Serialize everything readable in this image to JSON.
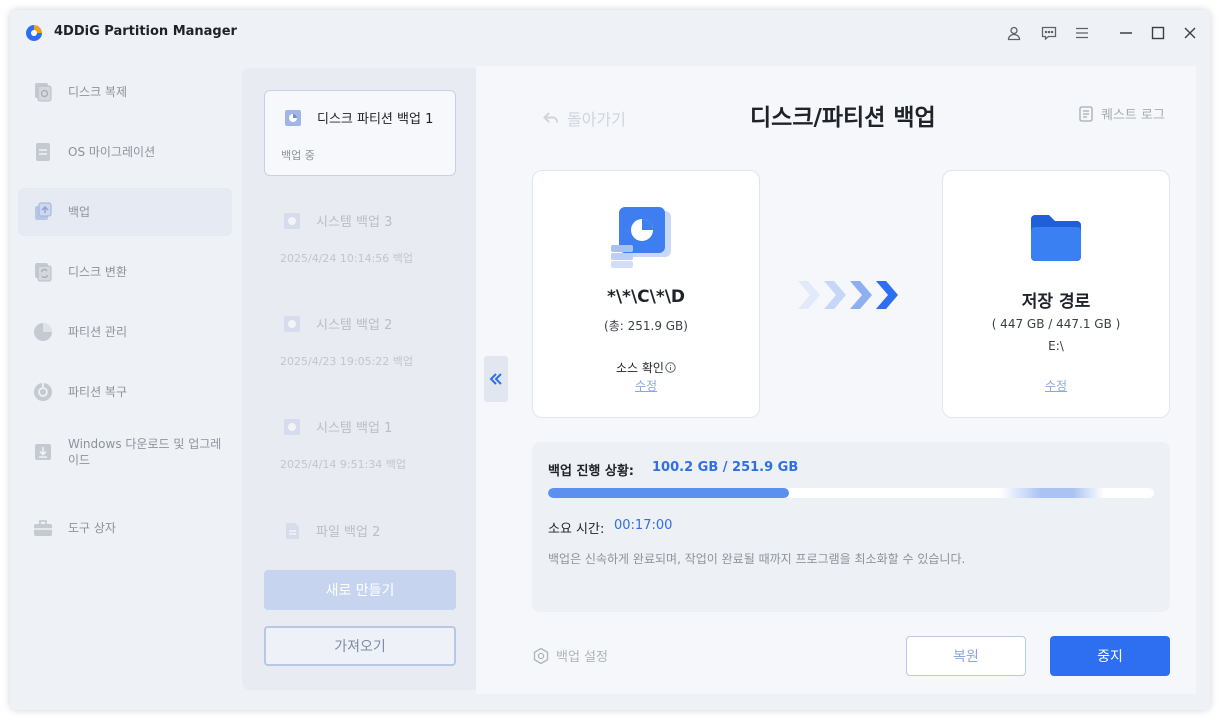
{
  "app": {
    "title": "4DDiG Partition Manager"
  },
  "titlebar_icons": [
    "user-icon",
    "feedback-icon",
    "menu-icon",
    "minimize-icon",
    "maximize-icon",
    "close-icon"
  ],
  "sidebar": {
    "items": [
      {
        "label": "디스크 복제",
        "icon": "disk-clone-icon",
        "active": false
      },
      {
        "label": "OS 마이그레이션",
        "icon": "os-migration-icon",
        "active": false
      },
      {
        "label": "백업",
        "icon": "backup-icon",
        "active": true
      },
      {
        "label": "디스크 변환",
        "icon": "disk-convert-icon",
        "active": false
      },
      {
        "label": "파티션 관리",
        "icon": "partition-manage-icon",
        "active": false
      },
      {
        "label": "파티션 복구",
        "icon": "partition-recovery-icon",
        "active": false
      },
      {
        "label": "Windows 다운로드 및 업그레이드",
        "icon": "windows-download-icon",
        "active": false
      },
      {
        "label": "도구 상자",
        "icon": "toolbox-icon",
        "active": false
      }
    ]
  },
  "backup_list": {
    "jobs": [
      {
        "title": "디스크 파티션 백업 1",
        "sub": "백업 중",
        "active": true
      },
      {
        "title": "시스템 백업 3",
        "sub": "2025/4/24 10:14:56 백업",
        "active": false
      },
      {
        "title": "시스템 백업 2",
        "sub": "2025/4/23 19:05:22 백업",
        "active": false
      },
      {
        "title": "시스템 백업 1",
        "sub": "2025/4/14 9:51:34 백업",
        "active": false
      },
      {
        "title": "파일 백업 2",
        "sub": "",
        "active": false
      }
    ],
    "new_label": "새로 만들기",
    "import_label": "가져오기"
  },
  "main": {
    "back_label": "돌아가기",
    "title": "디스크/파티션 백업",
    "log_label": "퀘스트 로그",
    "source": {
      "name": "*\\*\\C\\*\\D",
      "size": "(총: 251.9 GB)",
      "confirm_label": "소스 확인",
      "edit_label": "수정"
    },
    "destination": {
      "name": "저장 경로",
      "size": "( 447 GB / 447.1 GB )",
      "path": "E:\\",
      "edit_label": "수정"
    },
    "progress": {
      "label": "백업 진행 상황:",
      "value": "100.2 GB / 251.9 GB",
      "fraction": 0.398,
      "time_label": "소요 시간:",
      "time_value": "00:17:00",
      "note": "백업은 신속하게 완료되며, 작업이 완료될 때까지 프로그램을 최소화할 수 있습니다."
    },
    "settings_label": "백업 설정",
    "restore_label": "복원",
    "stop_label": "중지"
  },
  "colors": {
    "accent": "#2d6ff0",
    "progress": "#5b8ff0",
    "link": "#8ca7e0"
  }
}
